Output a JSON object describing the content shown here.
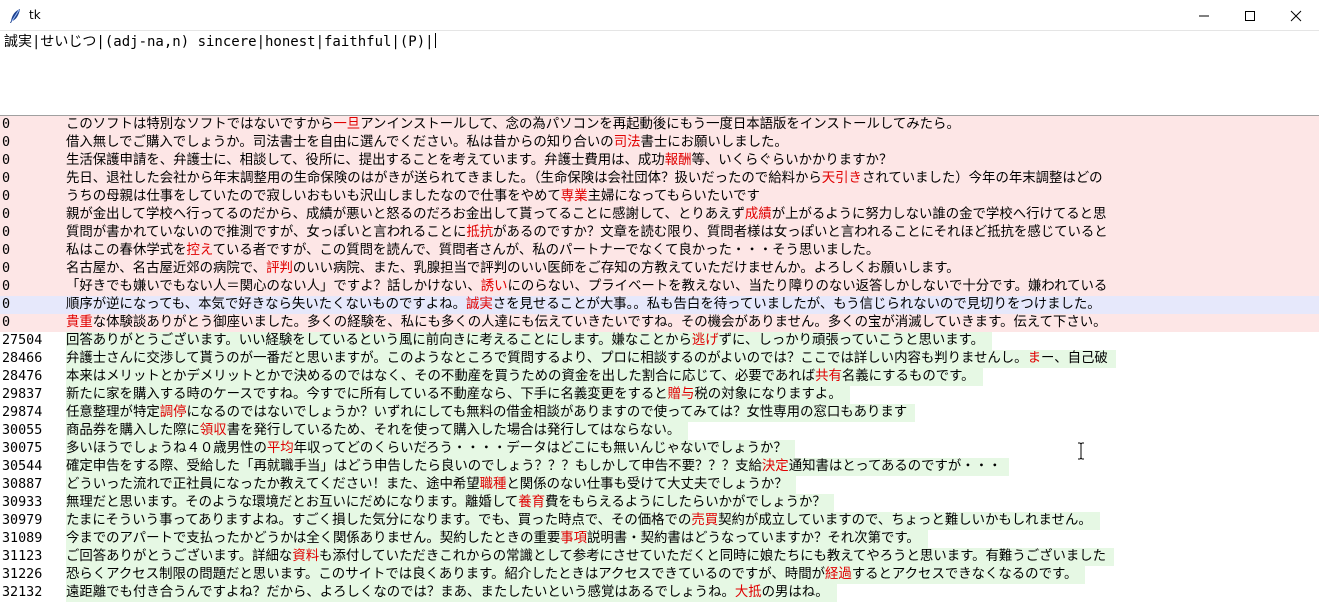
{
  "window": {
    "title": "tk"
  },
  "entry": {
    "value": "誠実|せいじつ|(adj-na,n) sincere|honest|faithful|(P)|"
  },
  "rows": [
    {
      "num": "0",
      "kind": "neg",
      "pre": "このソフトは特別なソフトではないですから",
      "hl": "一旦",
      "post": "アンインストールして、念の為パソコンを再起動後にもう一度日本語版をインストールしてみたら。"
    },
    {
      "num": "0",
      "kind": "neg",
      "pre": "借入無しでご購入でしょうか。司法書士を自由に選んでください。私は昔からの知り合いの",
      "hl": "司法",
      "post": "書士にお願いしました。"
    },
    {
      "num": "0",
      "kind": "neg",
      "pre": "生活保護申請を、弁護士に、相談して、役所に、提出することを考えています。弁護士費用は、成功",
      "hl": "報酬",
      "post": "等、いくらぐらいかかりますか？"
    },
    {
      "num": "0",
      "kind": "neg",
      "pre": "先日、退社した会社から年末調整用の生命保険のはがきが送られてきました。（生命保険は会社団体？扱いだったので給料から",
      "hl": "天引き",
      "post": "されていました）今年の年末調整はどの"
    },
    {
      "num": "0",
      "kind": "neg",
      "pre": "うちの母親は仕事をしていたので寂しいおもいも沢山しましたなので仕事をやめて",
      "hl": "専業",
      "post": "主婦になってもらいたいです"
    },
    {
      "num": "0",
      "kind": "neg",
      "pre": "親が金出して学校へ行ってるのだから、成績が悪いと怒るのだろお金出して貰ってることに感謝して、とりあえず",
      "hl": "成績",
      "post": "が上がるように努力しない誰の金で学校へ行けてると思"
    },
    {
      "num": "0",
      "kind": "neg",
      "pre": "質問が書かれていないので推測ですが、女っぽいと言われることに",
      "hl": "抵抗",
      "post": "があるのですか？文章を読む限り、質問者様は女っぽいと言われることにそれほど抵抗を感じていると"
    },
    {
      "num": "0",
      "kind": "neg",
      "pre": "私はこの春休学式を",
      "hl": "控え",
      "post": "ている者ですが、この質問を読んで、質問者さんが、私のパートナーでなくて良かった・・・そう思いました。"
    },
    {
      "num": "0",
      "kind": "neg",
      "pre": "名古屋か、名古屋近郊の病院で、",
      "hl": "評判",
      "post": "のいい病院、また、乳腺担当で評判のいい医師をご存知の方教えていただけませんか。よろしくお願いします。"
    },
    {
      "num": "0",
      "kind": "neg",
      "pre": "「好きでも嫌いでもない人＝関心のない人」ですよ？話しかけない、",
      "hl": "誘い",
      "post": "にのらない、プライベートを教えない、当たり障りのない返答しかしないで十分です。嫌われている"
    },
    {
      "num": "0",
      "kind": "sel",
      "pre": "順序が逆になっても、本気で好きなら失いたくないものですよね。",
      "hl": "誠実",
      "post": "さを見せることが大事。。私も告白を待っていましたが、もう信じられないので見切りをつけました。"
    },
    {
      "num": "0",
      "kind": "neg",
      "pre": "",
      "hl": "貴重",
      "post": "な体験談ありがとう御座いました。多くの経験を、私にも多くの人達にも伝えていきたいですね。その機会がありません。多くの宝が消滅していきます。伝えて下さい。"
    },
    {
      "num": "27504",
      "kind": "pos",
      "pre": "回答ありがとうございます。いい経験をしているという風に前向きに考えることにします。嫌なことから",
      "hl": "逃げ",
      "post": "ずに、しっかり頑張っていこうと思います。"
    },
    {
      "num": "28466",
      "kind": "pos",
      "pre": "弁護士さんに交渉して貰うのが一番だと思いますが。このようなところで質問するより、プロに相談するのがよいのでは？ここでは詳しい内容も判りませんし。",
      "hl": "ま",
      "post": "ー、自己破"
    },
    {
      "num": "28476",
      "kind": "pos",
      "pre": "本来はメリットとかデメリットとかで決めるのではなく、その不動産を買うための資金を出した割合に応じて、必要であれば",
      "hl": "共有",
      "post": "名義にするものです。"
    },
    {
      "num": "29837",
      "kind": "pos",
      "pre": "新たに家を購入する時のケースですね。今すでに所有している不動産なら、下手に名義変更をすると",
      "hl": "贈与",
      "post": "税の対象になりますよ。"
    },
    {
      "num": "29874",
      "kind": "pos",
      "pre": "任意整理が特定",
      "hl": "調停",
      "post": "になるのではないでしょうか？いずれにしても無料の借金相談がありますので使ってみては？女性専用の窓口もあります"
    },
    {
      "num": "30055",
      "kind": "pos",
      "pre": "商品券を購入した際に",
      "hl": "領収",
      "post": "書を発行しているため、それを使って購入した場合は発行してはならない。"
    },
    {
      "num": "30075",
      "kind": "pos",
      "pre": "多いほうでしょうね４０歳男性の",
      "hl": "平均",
      "post": "年収ってどのくらいだろう・・・・データはどこにも無いんじゃないでしょうか？"
    },
    {
      "num": "30544",
      "kind": "pos",
      "pre": "確定申告をする際、受給した「再就職手当」はどう申告したら良いのでしょう？？？もしかして申告不要？？？支給",
      "hl": "決定",
      "post": "通知書はとってあるのですが・・・"
    },
    {
      "num": "30887",
      "kind": "pos",
      "pre": "どういった流れで正社員になったか教えてください！また、途中希望",
      "hl": "職種",
      "post": "と関係のない仕事も受けて大丈夫でしょうか？"
    },
    {
      "num": "30933",
      "kind": "pos",
      "pre": "無理だと思います。そのような環境だとお互いにだめになります。離婚して",
      "hl": "養育",
      "post": "費をもらえるようにしたらいかがでしょうか？"
    },
    {
      "num": "30979",
      "kind": "pos",
      "pre": "たまにそういう事ってありますよね。すごく損した気分になります。でも、買った時点で、その価格での",
      "hl": "売買",
      "post": "契約が成立していますので、ちょっと難しいかもしれません。"
    },
    {
      "num": "31089",
      "kind": "pos",
      "pre": "今までのアパートで支払ったかどうかは全く関係ありません。契約したときの重要",
      "hl": "事項",
      "post": "説明書・契約書はどうなっていますか？それ次第です。"
    },
    {
      "num": "31123",
      "kind": "pos",
      "pre": "ご回答ありがとうございます。詳細な",
      "hl": "資料",
      "post": "も添付していただきこれからの常識として参考にさせていただくと同時に娘たちにも教えてやろうと思います。有難うございました"
    },
    {
      "num": "31226",
      "kind": "pos",
      "pre": "恐らくアクセス制限の問題だと思います。このサイトでは良くあります。紹介したときはアクセスできているのですが、時間が",
      "hl": "経過",
      "post": "するとアクセスできなくなるのです。"
    },
    {
      "num": "32132",
      "kind": "pos",
      "pre": "遠距離でも付き合うんですよね？だから、よろしくなのでは？まあ、またしたいという感覚はあるでしょうね。",
      "hl": "大抵",
      "post": "の男はね。"
    }
  ]
}
